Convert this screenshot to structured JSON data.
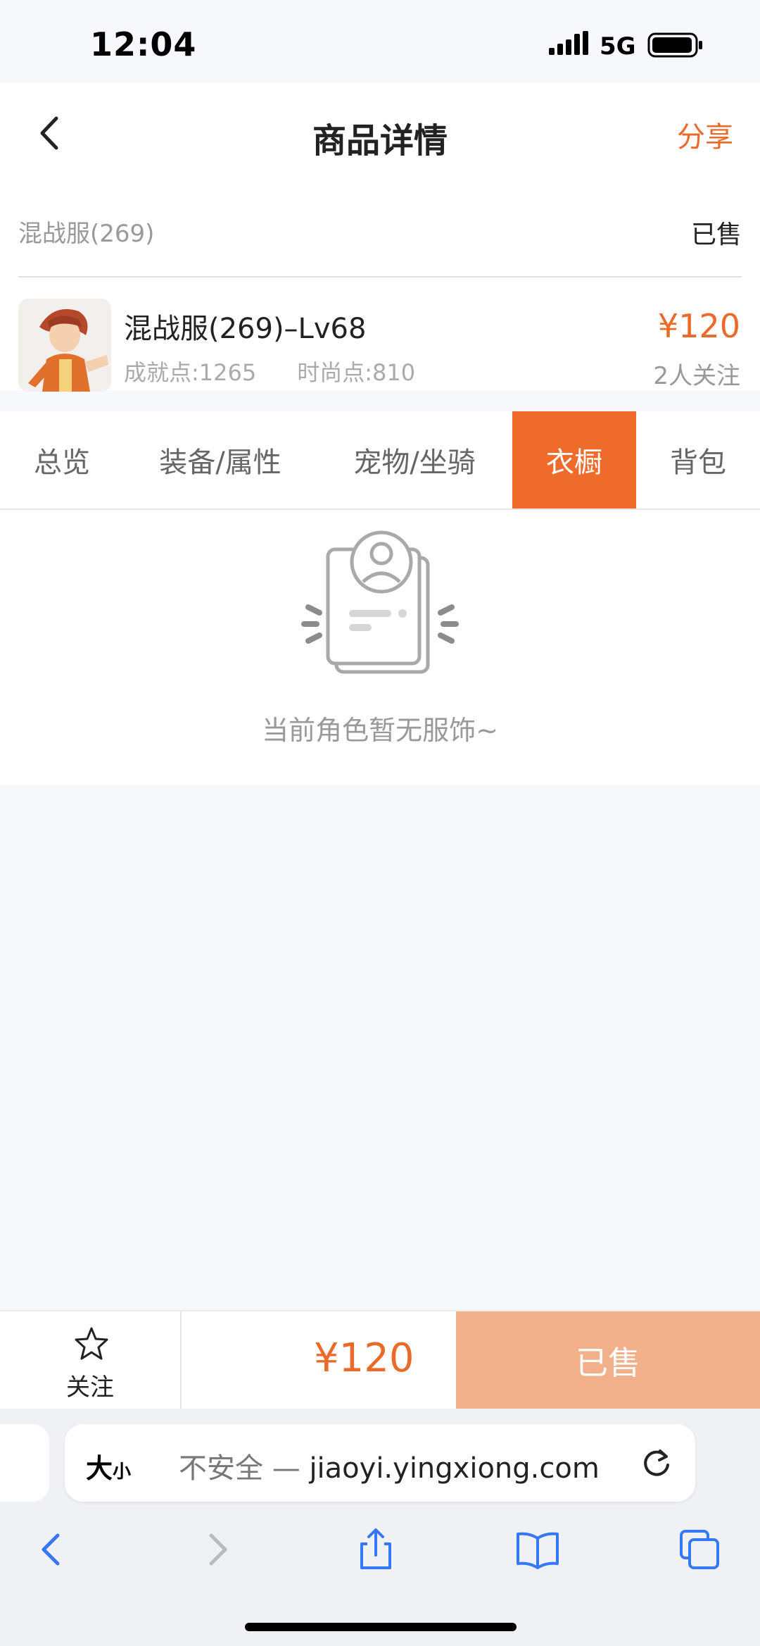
{
  "status_bar": {
    "time": "12:04",
    "network": "5G"
  },
  "header": {
    "title": "商品详情",
    "share_label": "分享"
  },
  "server": {
    "name": "混战服(269)",
    "status": "已售"
  },
  "product": {
    "title": "混战服(269)–Lv68",
    "achievement_points": "成就点:1265",
    "fashion_points": "时尚点:810",
    "price": "¥120",
    "followers": "2人关注"
  },
  "tabs": [
    {
      "label": "总览"
    },
    {
      "label": "装备/属性"
    },
    {
      "label": "宠物/坐骑"
    },
    {
      "label": "衣橱"
    },
    {
      "label": "背包"
    }
  ],
  "active_tab": "衣橱",
  "empty_state": {
    "message": "当前角色暂无服饰~"
  },
  "bottom_bar": {
    "follow_label": "关注",
    "price": "¥120",
    "buy_label": "已售"
  },
  "browser": {
    "text_size_label_big": "大",
    "text_size_label_small": "小",
    "url_prefix": "不安全 — ",
    "url": "jiaoyi.yingxiong.com"
  },
  "colors": {
    "accent": "#ea6a2a",
    "active_tab": "#ef6b2c",
    "sold_button": "#f2b08a",
    "ios_blue": "#3478f6"
  }
}
